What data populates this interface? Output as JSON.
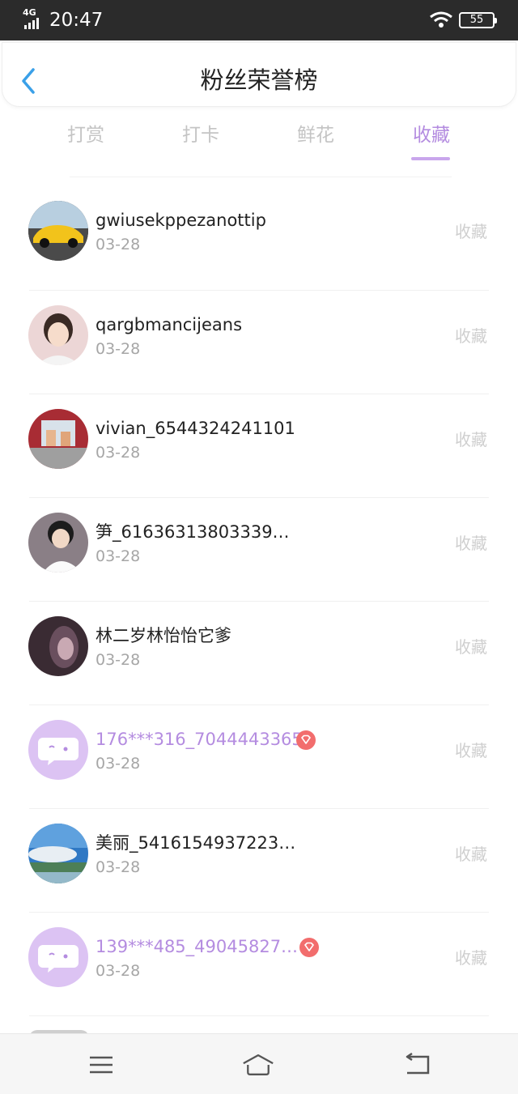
{
  "status_bar": {
    "network": "4G",
    "time": "20:47",
    "battery": "55"
  },
  "header": {
    "title": "粉丝荣誉榜"
  },
  "tabs": [
    {
      "label": "打赏"
    },
    {
      "label": "打卡"
    },
    {
      "label": "鲜花"
    },
    {
      "label": "收藏"
    }
  ],
  "active_tab": "收藏",
  "rows": [
    {
      "name": "gwiusekppezanottip",
      "date": "03-28",
      "action": "收藏"
    },
    {
      "name": "qargbmancijeans",
      "date": "03-28",
      "action": "收藏"
    },
    {
      "name": "vivian_6544324241101",
      "date": "03-28",
      "action": "收藏"
    },
    {
      "name": "笋_61636313803339…",
      "date": "03-28",
      "action": "收藏"
    },
    {
      "name": "林二岁林怡怡它爹",
      "date": "03-28",
      "action": "收藏"
    },
    {
      "name": "176***316_7044443365",
      "date": "03-28",
      "action": "收藏"
    },
    {
      "name": "美丽_5416154937223…",
      "date": "03-28",
      "action": "收藏"
    },
    {
      "name": "139***485_49045827…",
      "date": "03-28",
      "action": "收藏"
    }
  ],
  "icons": {
    "back": "chevron-left-icon",
    "vip": "diamond-badge-icon",
    "menu": "menu-icon",
    "home": "home-icon",
    "return": "return-icon"
  },
  "colors": {
    "accent": "#b48ce0",
    "vip_badge": "#f26d6d",
    "back_arrow": "#3aa0e8"
  }
}
